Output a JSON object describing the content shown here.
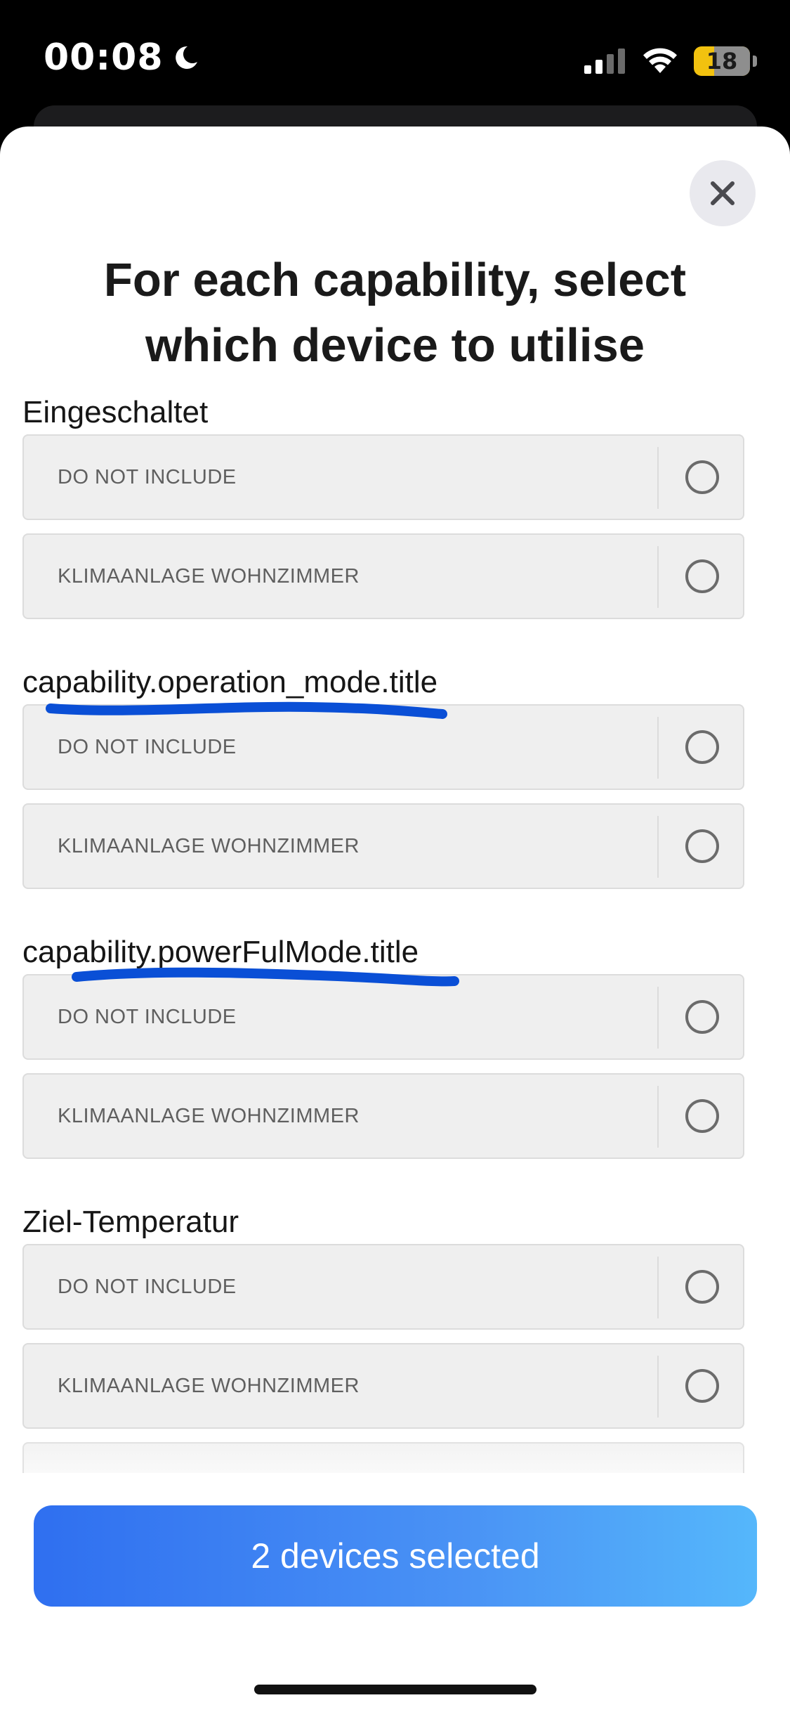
{
  "status_bar": {
    "time": "00:08",
    "battery": "18",
    "icons": [
      "moon-icon",
      "cellular-signal-icon",
      "wifi-icon",
      "battery-icon"
    ]
  },
  "modal": {
    "title": "For each capability, select which device to utilise",
    "close_icon": "close-icon"
  },
  "sections": [
    {
      "label": "Eingeschaltet",
      "options": [
        {
          "label": "DO NOT INCLUDE",
          "selected": false
        },
        {
          "label": "KLIMAANLAGE WOHNZIMMER",
          "selected": false
        }
      ]
    },
    {
      "label": "capability.operation_mode.title",
      "options": [
        {
          "label": "DO NOT INCLUDE",
          "selected": false
        },
        {
          "label": "KLIMAANLAGE WOHNZIMMER",
          "selected": false
        }
      ]
    },
    {
      "label": "capability.powerFulMode.title",
      "options": [
        {
          "label": "DO NOT INCLUDE",
          "selected": false
        },
        {
          "label": "KLIMAANLAGE WOHNZIMMER",
          "selected": false
        }
      ]
    },
    {
      "label": "Ziel-Temperatur",
      "options": [
        {
          "label": "DO NOT INCLUDE",
          "selected": false
        },
        {
          "label": "KLIMAANLAGE WOHNZIMMER",
          "selected": false
        }
      ]
    }
  ],
  "footer": {
    "button_label": "2 devices selected"
  },
  "colors": {
    "annotation_underline": "#0a4fd6",
    "button_gradient_start": "#2f6ff0",
    "button_gradient_end": "#55b7fb"
  }
}
